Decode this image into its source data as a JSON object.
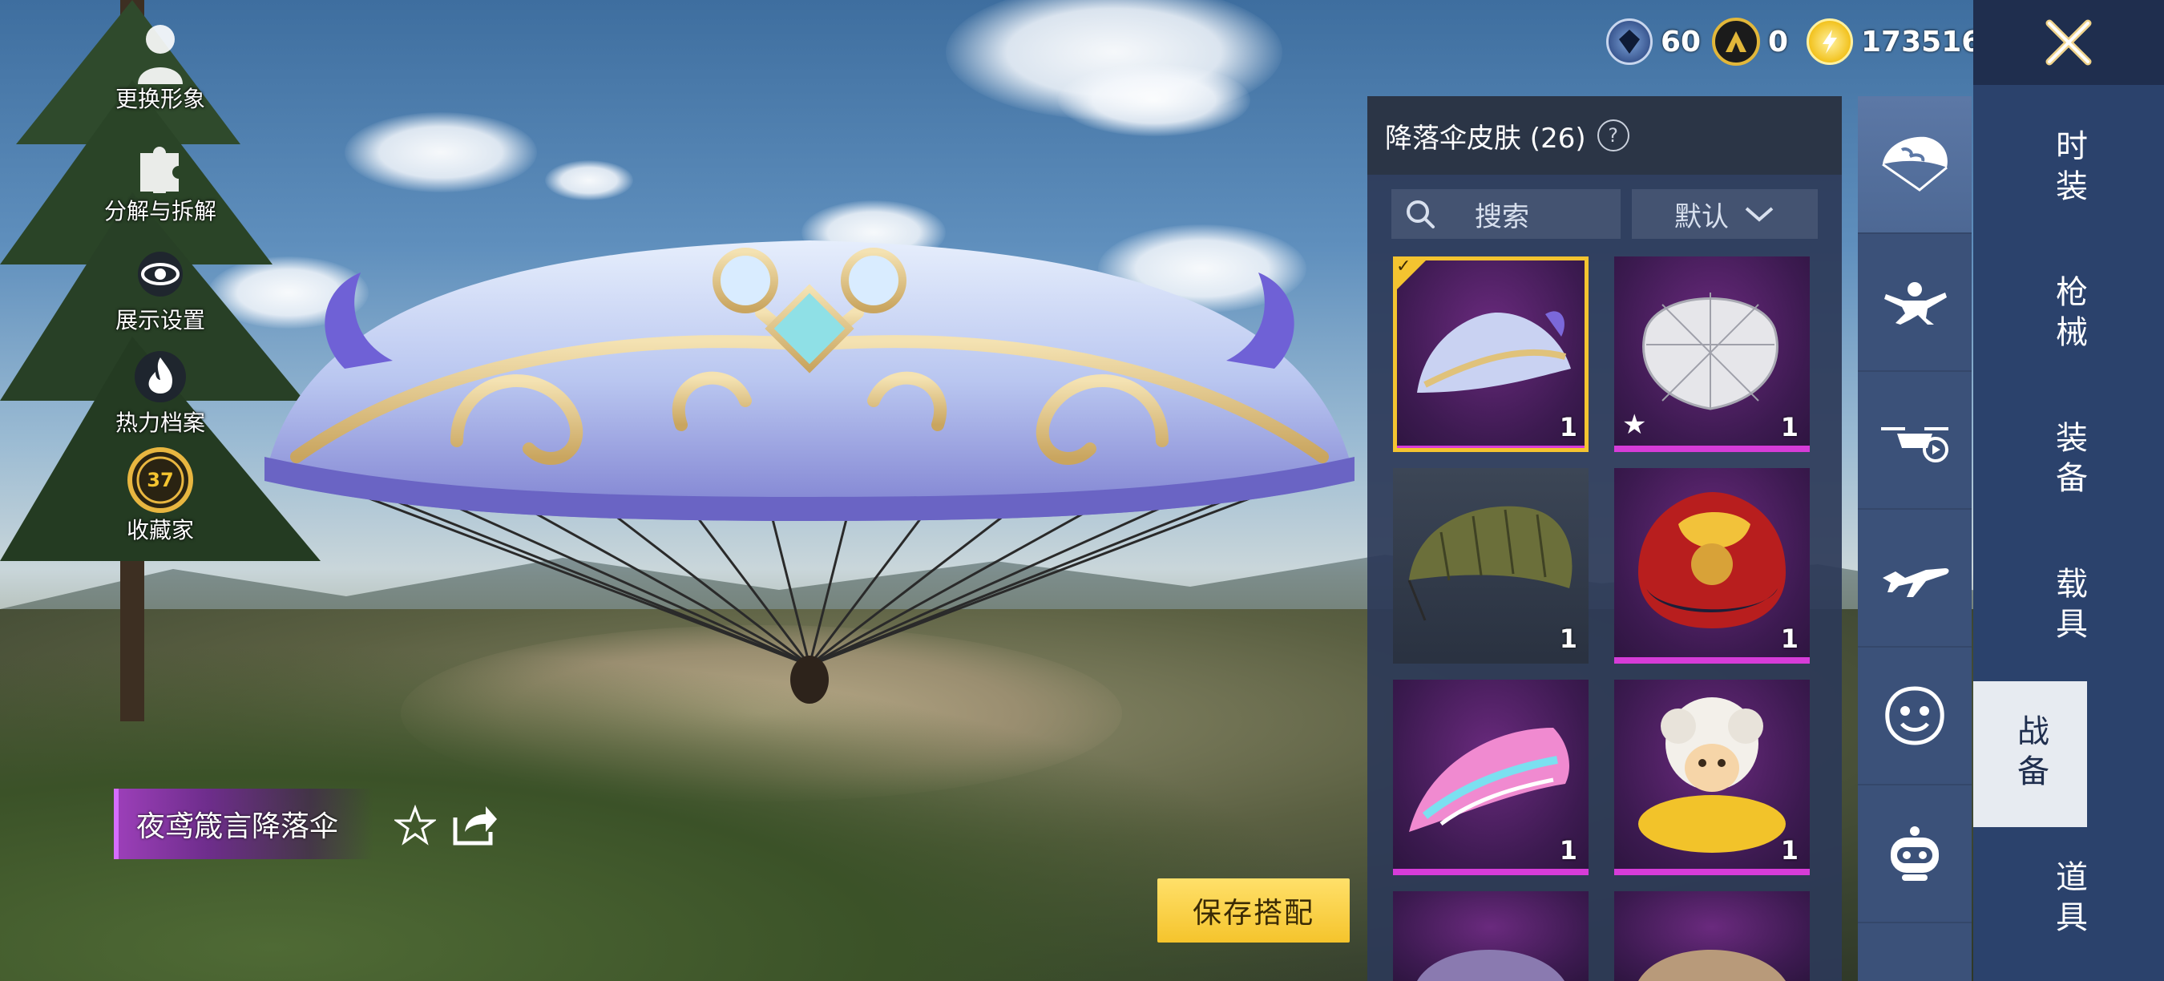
{
  "side_menu": [
    {
      "label": "更换形象",
      "icon": "avatar-icon"
    },
    {
      "label": "分解与拆解",
      "icon": "puzzle-icon"
    },
    {
      "label": "展示设置",
      "icon": "eye-icon"
    },
    {
      "label": "热力档案",
      "icon": "flame-icon"
    },
    {
      "label": "收藏家",
      "badge": "37",
      "icon": "collector-badge-icon"
    }
  ],
  "item": {
    "name": "夜鸢箴言降落伞"
  },
  "save_label": "保存搭配",
  "currency": {
    "c1": "60",
    "c2": "0",
    "c3": "173516"
  },
  "panel": {
    "title": "降落伞皮肤 (26)",
    "help": "?",
    "search_label": "搜索",
    "sort_label": "默认"
  },
  "cards": [
    {
      "qty": "1",
      "rarity": "purple",
      "selected": true,
      "star": false,
      "art": "ornate-parachute"
    },
    {
      "qty": "1",
      "rarity": "purple",
      "selected": false,
      "star": true,
      "art": "diamond-parachute"
    },
    {
      "qty": "1",
      "rarity": "gray",
      "selected": false,
      "star": false,
      "art": "olive-parachute"
    },
    {
      "qty": "1",
      "rarity": "purple",
      "selected": false,
      "star": false,
      "art": "dragon-parachute"
    },
    {
      "qty": "1",
      "rarity": "purple",
      "selected": false,
      "star": false,
      "art": "pink-graffiti-parachute"
    },
    {
      "qty": "1",
      "rarity": "purple",
      "selected": false,
      "star": false,
      "art": "sheep-parachute"
    }
  ],
  "categories": [
    "parachute-icon",
    "skydiver-icon",
    "drone-icon",
    "airplane-icon",
    "emote-face-icon",
    "robot-icon"
  ],
  "tabs": [
    {
      "label": "时装"
    },
    {
      "label": "枪械"
    },
    {
      "label": "装备"
    },
    {
      "label": "载具"
    },
    {
      "label": "战备",
      "active": true
    },
    {
      "label": "道具"
    }
  ],
  "colors": {
    "accent": "#f4c430",
    "purple_rarity": "#d63cd8",
    "tab_active": "#e7ebf1",
    "panel_bg": "#2c3a58"
  }
}
